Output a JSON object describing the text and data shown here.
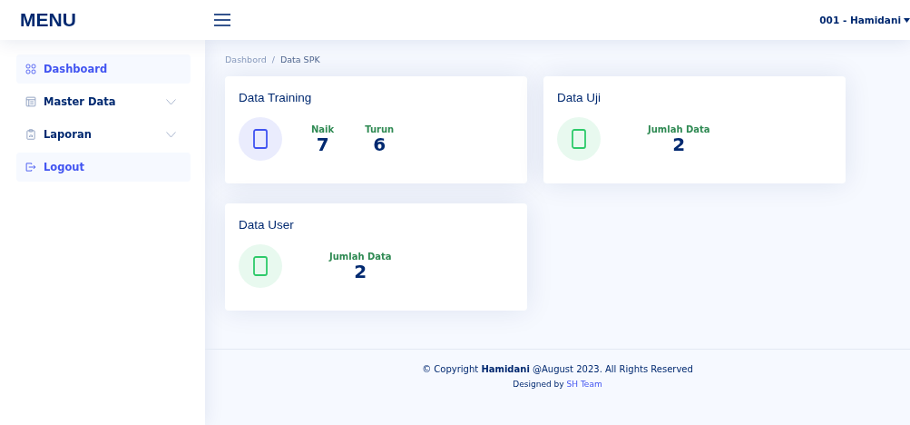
{
  "header": {
    "logo": "MENU",
    "user": "001 - Hamidani"
  },
  "sidebar": {
    "items": [
      {
        "label": "Dashboard",
        "kind": "grid",
        "collapsed": false,
        "has_submenu": false
      },
      {
        "label": "Master Data",
        "kind": "table",
        "collapsed": true,
        "has_submenu": true
      },
      {
        "label": "Laporan",
        "kind": "report",
        "collapsed": true,
        "has_submenu": true
      },
      {
        "label": "Logout",
        "kind": "logout",
        "collapsed": false,
        "has_submenu": false
      }
    ]
  },
  "breadcrumb": {
    "link": "Dashbord",
    "separator": "/",
    "current": "Data SPK"
  },
  "cards": [
    {
      "title": "Data Training",
      "color": "#4154f1",
      "stats": [
        {
          "label": "Naik",
          "value": "7"
        },
        {
          "label": "Turun",
          "value": "6"
        }
      ]
    },
    {
      "title": "Data Uji",
      "color": "#2eca6a",
      "stats": [
        {
          "label": "Jumlah Data",
          "value": "2"
        }
      ]
    },
    {
      "title": "Data User",
      "color": "#2eca6a",
      "stats": [
        {
          "label": "Jumlah Data",
          "value": "2"
        }
      ]
    }
  ],
  "footer": {
    "copyright": "© Copyright **Hamidani** @August 2023. All Rights Reserved",
    "designed_by": "Designed by",
    "team": "SH Team"
  }
}
